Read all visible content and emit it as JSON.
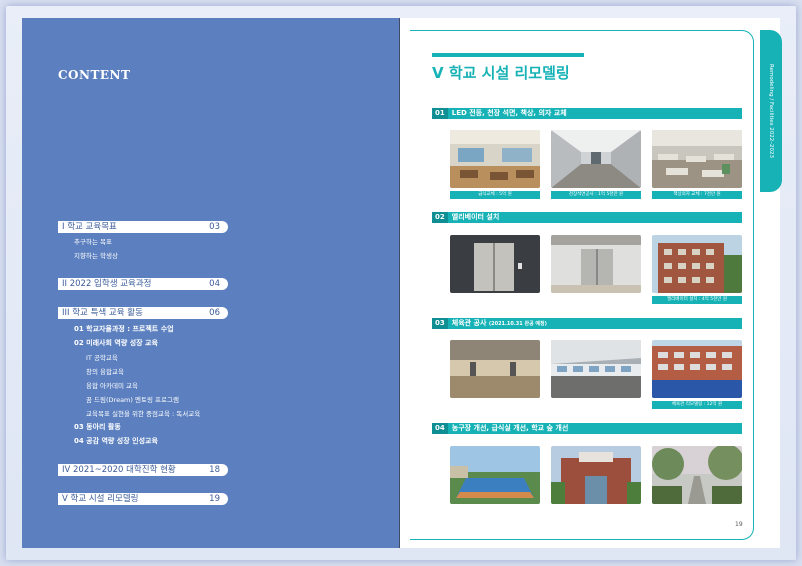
{
  "left_page": {
    "heading": "CONTENT",
    "toc": [
      {
        "label": "I  학교 교육목표",
        "page": "03"
      },
      {
        "label": "II  2022 입학생 교육과정",
        "page": "04"
      },
      {
        "label": "III  학교 특색 교육 활동",
        "page": "06"
      },
      {
        "label": "IV  2021~2020 대학진학 현황",
        "page": "18"
      },
      {
        "label": "V  학교 시설 리모델링",
        "page": "19"
      }
    ],
    "sub_items_1": [
      "추구하는 목표",
      "지향하는 학생상"
    ],
    "sub_items_3": [
      {
        "label": "01 학교자율과정 : 프로젝트 수업",
        "bold": true
      },
      {
        "label": "02 미래사회 역량 성장 교육",
        "bold": true
      },
      {
        "label": "IT 공학교육",
        "bold": false
      },
      {
        "label": "창의 융합교육",
        "bold": false
      },
      {
        "label": "융합 아카데미 교육",
        "bold": false
      },
      {
        "label": "꿈 드림(Dream) 멘토링 프로그램",
        "bold": false
      },
      {
        "label": "교육목표 실현을 위한 중점교육 : 독서교육",
        "bold": false
      },
      {
        "label": "03 동아리 활동",
        "bold": true
      },
      {
        "label": "04 공감 역량 성장 인성교육",
        "bold": true
      }
    ]
  },
  "right_page": {
    "title": "V  학교 시설 리모델링",
    "side_tab": "Remodeling / Facilities 2022–2023",
    "sections": [
      {
        "num": "01",
        "label": "LED 전등, 천장 석면, 책상, 의자 교체",
        "note": "",
        "captions": [
          "급식교체 : 5억 원",
          "천장석면공사 : 1억 5천만 원",
          "책상의자 교체 : 7천만 원"
        ]
      },
      {
        "num": "02",
        "label": "엘리베이터 설치",
        "note": "",
        "captions": [
          "",
          "",
          "엘리베이터 설치 : 4억 5천만 원"
        ]
      },
      {
        "num": "03",
        "label": "체육관 공사",
        "note": "(2021.10.31 완공 예정)",
        "captions": [
          "",
          "",
          "체육관 리모델링 : 12억 원"
        ]
      },
      {
        "num": "04",
        "label": "농구장 개선, 급식실 개선, 학교 숲 개선",
        "note": "",
        "captions": [
          "",
          "",
          ""
        ]
      }
    ],
    "page_number": "19"
  }
}
